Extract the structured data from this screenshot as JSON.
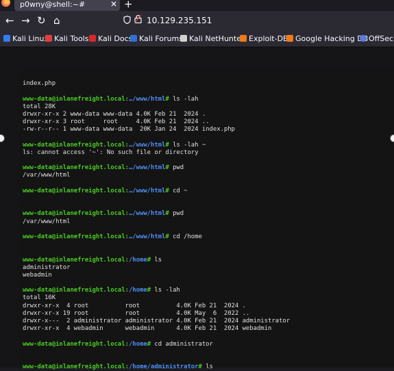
{
  "browser": {
    "tab_title": "p0wny@shell:~#",
    "tab_close": "✕",
    "new_tab": "+",
    "back": "←",
    "forward": "→",
    "reload": "↻",
    "home": "⌂",
    "url": "10.129.235.151",
    "shield_icon": "shield",
    "lock_icon": "lock"
  },
  "bookmarks": [
    {
      "label": "Kali Linux",
      "icon": "kali-dragon",
      "color": "#367bf0"
    },
    {
      "label": "Kali Tools",
      "icon": "kali-tools",
      "color": "#e23f3f"
    },
    {
      "label": "Kali Docs",
      "icon": "kali-docs",
      "color": "#d62828"
    },
    {
      "label": "Kali Forums",
      "icon": "kali-forums",
      "color": "#2f6fd6"
    },
    {
      "label": "Kali NetHunter",
      "icon": "nethunter",
      "color": "#d0d0d0"
    },
    {
      "label": "Exploit-DB",
      "icon": "exploit-db",
      "color": "#f07a18"
    },
    {
      "label": "Google Hacking DB",
      "icon": "ghdb",
      "color": "#f07a18"
    },
    {
      "label": "OffSec",
      "icon": "offsec",
      "color": "#5a7be0"
    }
  ],
  "terminal": {
    "lines": [
      {
        "type": "blank"
      },
      {
        "type": "output",
        "text": "index.php"
      },
      {
        "type": "blank"
      },
      {
        "type": "prompt",
        "user": "www-data@inlanefreight.local",
        "path": "…/www/html",
        "cmd": "ls -lah"
      },
      {
        "type": "output",
        "text": "total 28K"
      },
      {
        "type": "output",
        "text": "drwxr-xr-x 2 www-data www-data 4.0K Feb 21  2024 ."
      },
      {
        "type": "output",
        "text": "drwxr-xr-x 3 root     root     4.0K Feb 21  2024 .."
      },
      {
        "type": "output",
        "text": "-rw-r--r-- 1 www-data www-data  20K Jan 24  2024 index.php"
      },
      {
        "type": "blank"
      },
      {
        "type": "prompt",
        "user": "www-data@inlanefreight.local",
        "path": "…/www/html",
        "cmd": "ls -lah ~"
      },
      {
        "type": "output",
        "text": "ls: cannot access '~': No such file or directory"
      },
      {
        "type": "blank"
      },
      {
        "type": "prompt",
        "user": "www-data@inlanefreight.local",
        "path": "…/www/html",
        "cmd": "pwd"
      },
      {
        "type": "output",
        "text": "/var/www/html"
      },
      {
        "type": "blank"
      },
      {
        "type": "prompt",
        "user": "www-data@inlanefreight.local",
        "path": "…/www/html",
        "cmd": "cd ~"
      },
      {
        "type": "blank"
      },
      {
        "type": "blank"
      },
      {
        "type": "prompt",
        "user": "www-data@inlanefreight.local",
        "path": "…/www/html",
        "cmd": "pwd"
      },
      {
        "type": "output",
        "text": "/var/www/html"
      },
      {
        "type": "blank"
      },
      {
        "type": "prompt",
        "user": "www-data@inlanefreight.local",
        "path": "…/www/html",
        "cmd": "cd /home"
      },
      {
        "type": "blank"
      },
      {
        "type": "blank"
      },
      {
        "type": "prompt",
        "user": "www-data@inlanefreight.local",
        "path": "/home",
        "cmd": "ls"
      },
      {
        "type": "output",
        "text": "administrator"
      },
      {
        "type": "output",
        "text": "webadmin"
      },
      {
        "type": "blank"
      },
      {
        "type": "prompt",
        "user": "www-data@inlanefreight.local",
        "path": "/home",
        "cmd": "ls -lah"
      },
      {
        "type": "output",
        "text": "total 16K"
      },
      {
        "type": "output",
        "text": "drwxr-xr-x  4 root          root          4.0K Feb 21  2024 ."
      },
      {
        "type": "output",
        "text": "drwxr-xr-x 19 root          root          4.0K May  6  2022 .."
      },
      {
        "type": "output",
        "text": "drwxr-x---  2 administrator administrator 4.0K Feb 21  2024 administrator"
      },
      {
        "type": "output",
        "text": "drwxr-xr-x  4 webadmin      webadmin      4.0K Feb 21  2024 webadmin"
      },
      {
        "type": "blank"
      },
      {
        "type": "prompt",
        "user": "www-data@inlanefreight.local",
        "path": "/home",
        "cmd": "cd administrator"
      },
      {
        "type": "blank"
      },
      {
        "type": "blank"
      },
      {
        "type": "prompt",
        "user": "www-data@inlanefreight.local",
        "path": "/home/administrator",
        "cmd": "ls"
      }
    ]
  }
}
